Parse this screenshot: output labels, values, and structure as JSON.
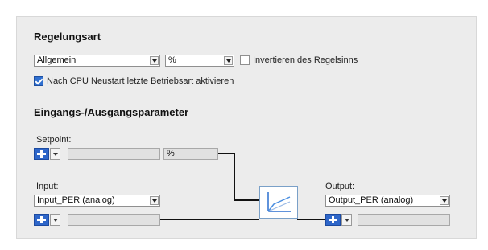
{
  "control_type": {
    "title": "Regelungsart",
    "type_select": "Allgemein",
    "unit_select": "%",
    "invert_label": "Invertieren des Regelsinns",
    "invert_checked": false,
    "restart_label": "Nach CPU Neustart letzte Betriebsart aktivieren",
    "restart_checked": true
  },
  "io_params": {
    "title": "Eingangs-/Ausgangsparameter",
    "setpoint": {
      "label": "Setpoint:",
      "value": "",
      "unit": "%"
    },
    "input": {
      "label": "Input:",
      "select": "Input_PER (analog)",
      "value": ""
    },
    "output": {
      "label": "Output:",
      "select": "Output_PER (analog)",
      "value": ""
    }
  },
  "icons": {
    "connector": "interconnection-icon",
    "controller": "pid-controller-icon"
  },
  "colors": {
    "accent": "#2f6fd0",
    "panel_bg": "#ececec",
    "wire": "#111111"
  }
}
